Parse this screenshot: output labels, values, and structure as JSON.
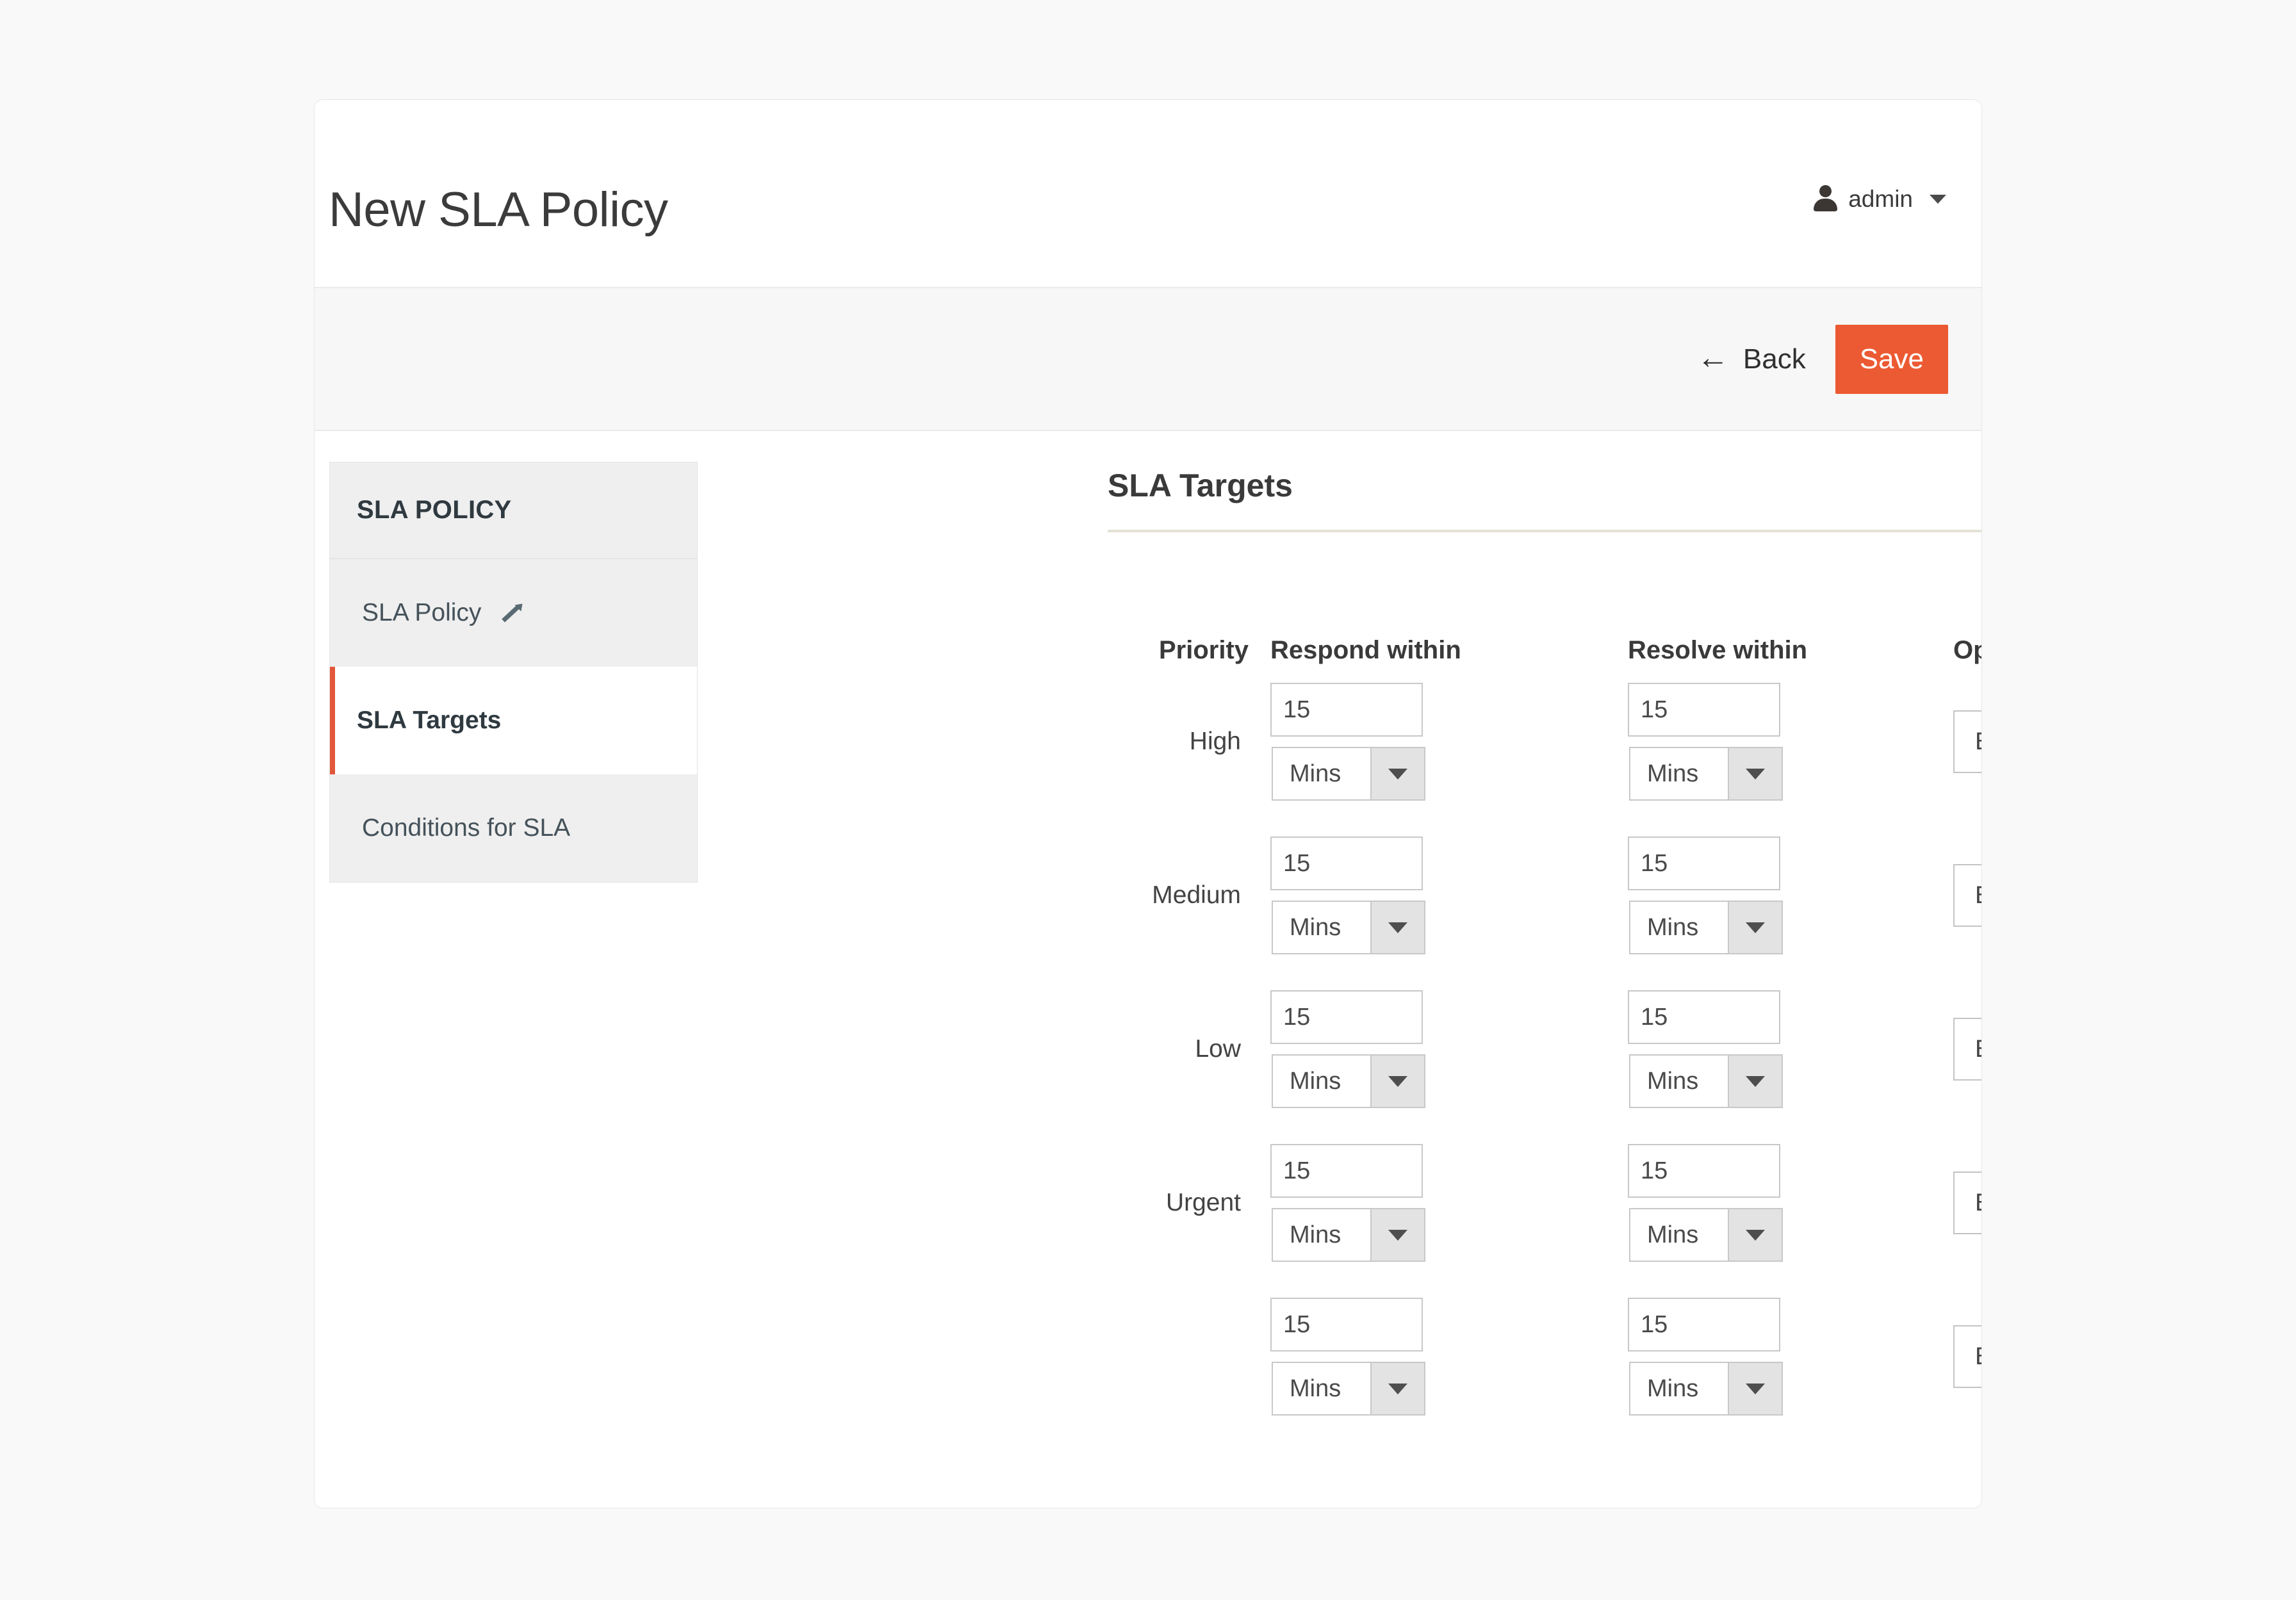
{
  "header": {
    "title": "New SLA Policy",
    "user": {
      "name": "admin",
      "avatar_icon": "person-icon",
      "caret_icon": "caret-down-icon"
    }
  },
  "toolbar": {
    "back_label": "Back",
    "back_icon": "arrow-left-icon",
    "save_label": "Save",
    "save_color": "#ec5a33"
  },
  "sidebar": {
    "title": "SLA POLICY",
    "items": [
      {
        "label": "SLA Policy",
        "icon": "pencil-icon",
        "active": false
      },
      {
        "label": "SLA Targets",
        "icon": null,
        "active": true
      },
      {
        "label": "Conditions for SLA",
        "icon": null,
        "active": false
      }
    ],
    "active_accent": "#e2573a"
  },
  "main": {
    "section_title": "SLA Targets",
    "columns": {
      "priority": "Priority",
      "respond": "Respond within",
      "resolve": "Resolve within",
      "operational": "Operational Hrs"
    },
    "rows": [
      {
        "priority": "High",
        "respond_value": "15",
        "respond_unit": "Mins",
        "resolve_value": "15",
        "resolve_unit": "Mins",
        "operational_hours": "Business"
      },
      {
        "priority": "Medium",
        "respond_value": "15",
        "respond_unit": "Mins",
        "resolve_value": "15",
        "resolve_unit": "Mins",
        "operational_hours": "Business"
      },
      {
        "priority": "Low",
        "respond_value": "15",
        "respond_unit": "Mins",
        "resolve_value": "15",
        "resolve_unit": "Mins",
        "operational_hours": "Business"
      },
      {
        "priority": "Urgent",
        "respond_value": "15",
        "respond_unit": "Mins",
        "resolve_value": "15",
        "resolve_unit": "Mins",
        "operational_hours": "Business"
      },
      {
        "priority": "",
        "respond_value": "15",
        "respond_unit": "Mins",
        "resolve_value": "15",
        "resolve_unit": "Mins",
        "operational_hours": "Business"
      }
    ]
  }
}
